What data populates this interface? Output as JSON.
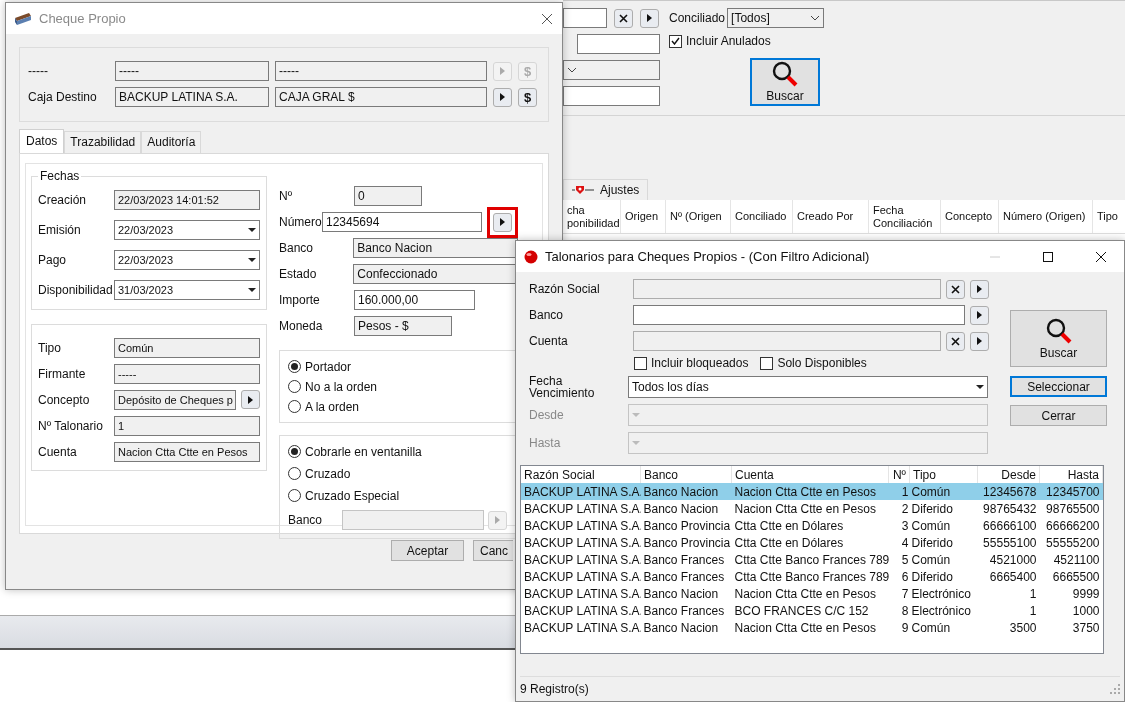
{
  "main_window": {
    "conciliado": {
      "label": "Conciliado",
      "value": "[Todos]"
    },
    "incluir_anulados": {
      "label": "Incluir Anulados",
      "checked": true
    },
    "search_button": "Buscar",
    "tabs": [
      {
        "label": "Ajustes"
      }
    ],
    "grid_columns": [
      "cha ponibilidad",
      "Origen",
      "Nº (Origen",
      "Conciliado",
      "Creado Por",
      "Fecha Conciliación",
      "Concepto",
      "Número (Origen)",
      "Tipo"
    ]
  },
  "cheque_dialog": {
    "title": "Cheque Propio",
    "header_rows": [
      {
        "label": "-----",
        "values": [
          "-----",
          "-----"
        ],
        "currency_button": "$",
        "disabled": true
      },
      {
        "label": "Caja Destino",
        "values": [
          "BACKUP LATINA S.A.",
          "CAJA GRAL $"
        ],
        "currency_button": "$",
        "disabled": false
      }
    ],
    "tabs": [
      {
        "label": "Datos",
        "selected": true
      },
      {
        "label": "Trazabilidad",
        "selected": false
      },
      {
        "label": "Auditoría",
        "selected": false
      }
    ],
    "fechas": {
      "title": "Fechas",
      "fields": [
        {
          "label": "Creación",
          "value": "22/03/2023 14:01:52",
          "kind": "readonly"
        },
        {
          "label": "Emisión",
          "value": "22/03/2023",
          "kind": "date"
        },
        {
          "label": "Pago",
          "value": "22/03/2023",
          "kind": "date"
        },
        {
          "label": "Disponibilidad",
          "value": "31/03/2023",
          "kind": "date"
        }
      ]
    },
    "details": [
      {
        "label": "Tipo",
        "value": "Común",
        "kind": "readonly"
      },
      {
        "label": "Firmante",
        "value": "-----",
        "kind": "readonly"
      },
      {
        "label": "Concepto",
        "value": "Depósito de Cheques p",
        "kind": "lookup"
      },
      {
        "label": "Nº Talonario",
        "value": "1",
        "kind": "readonly"
      },
      {
        "label": "Cuenta",
        "value": "Nacion Ctta Ctte en Pesos",
        "kind": "readonly"
      }
    ],
    "right_fields": [
      {
        "label": "Nº",
        "value": "0",
        "kind": "readonly"
      },
      {
        "label": "Número",
        "value": "12345694",
        "kind": "lookup_input",
        "highlighted": true
      },
      {
        "label": "Banco",
        "value": "Banco Nacion",
        "kind": "readonly"
      },
      {
        "label": "Estado",
        "value": "Confeccionado",
        "kind": "readonly"
      },
      {
        "label": "Importe",
        "value": "160.000,00",
        "kind": "input"
      },
      {
        "label": "Moneda",
        "value": "Pesos - $",
        "kind": "readonly"
      }
    ],
    "endorsement": [
      {
        "label": "Portador",
        "selected": true
      },
      {
        "label": "No a la orden",
        "selected": false
      },
      {
        "label": "A la orden",
        "selected": false
      }
    ],
    "crossing": {
      "options": [
        {
          "label": "Cobrarle en ventanilla",
          "selected": true
        },
        {
          "label": "Cruzado",
          "selected": false
        },
        {
          "label": "Cruzado Especial",
          "selected": false
        }
      ],
      "bank_label": "Banco"
    },
    "buttons": [
      "Aceptar",
      "Canc"
    ]
  },
  "talonarios_dialog": {
    "title": "Talonarios para Cheques Propios - (Con Filtro Adicional)",
    "filters": [
      {
        "label": "Razón Social",
        "disabled": true,
        "clearable": true
      },
      {
        "label": "Banco",
        "disabled": false,
        "clearable": false
      },
      {
        "label": "Cuenta",
        "disabled": true,
        "clearable": true
      }
    ],
    "checkboxes": [
      {
        "label": "Incluir bloqueados",
        "checked": false
      },
      {
        "label": "Solo Disponibles",
        "checked": false
      }
    ],
    "date_filters": [
      {
        "label": "Fecha Vencimiento",
        "value": "Todos los días",
        "disabled": false
      },
      {
        "label": "Desde",
        "disabled": true
      },
      {
        "label": "Hasta",
        "disabled": true
      }
    ],
    "search_button": "Buscar",
    "select_button": "Seleccionar",
    "close_button": "Cerrar",
    "table": {
      "columns": [
        "Razón Social",
        "Banco",
        "Cuenta",
        "Nº",
        "Tipo",
        "Desde",
        "Hasta"
      ],
      "rows": [
        {
          "cells": [
            "BACKUP LATINA S.A.",
            "Banco Nacion",
            "Nacion Ctta Ctte en Pesos",
            "1",
            "Común",
            "12345678",
            "12345700"
          ],
          "selected": true
        },
        {
          "cells": [
            "BACKUP LATINA S.A.",
            "Banco Nacion",
            "Nacion Ctta Ctte en Pesos",
            "2",
            "Diferido",
            "98765432",
            "98765500"
          ],
          "selected": false
        },
        {
          "cells": [
            "BACKUP LATINA S.A.",
            "Banco Provincia",
            "Ctta Ctte en Dólares",
            "3",
            "Común",
            "66666100",
            "66666200"
          ],
          "selected": false
        },
        {
          "cells": [
            "BACKUP LATINA S.A.",
            "Banco Provincia",
            "Ctta Ctte en Dólares",
            "4",
            "Diferido",
            "55555100",
            "55555200"
          ],
          "selected": false
        },
        {
          "cells": [
            "BACKUP LATINA S.A.",
            "Banco Frances",
            "Ctta Ctte Banco Frances 789",
            "5",
            "Común",
            "4521000",
            "4521100"
          ],
          "selected": false
        },
        {
          "cells": [
            "BACKUP LATINA S.A.",
            "Banco Frances",
            "Ctta Ctte Banco Frances 789",
            "6",
            "Diferido",
            "6665400",
            "6665500"
          ],
          "selected": false
        },
        {
          "cells": [
            "BACKUP LATINA S.A.",
            "Banco Nacion",
            "Nacion Ctta Ctte en Pesos",
            "7",
            "Electrónico",
            "1",
            "9999"
          ],
          "selected": false
        },
        {
          "cells": [
            "BACKUP LATINA S.A.",
            "Banco Frances",
            "BCO FRANCES C/C 152",
            "8",
            "Electrónico",
            "1",
            "1000"
          ],
          "selected": false
        },
        {
          "cells": [
            "BACKUP LATINA S.A.",
            "Banco Nacion",
            "Nacion Ctta Ctte en Pesos",
            "9",
            "Común",
            "3500",
            "3750"
          ],
          "selected": false
        }
      ]
    },
    "status": "9 Registro(s)"
  }
}
